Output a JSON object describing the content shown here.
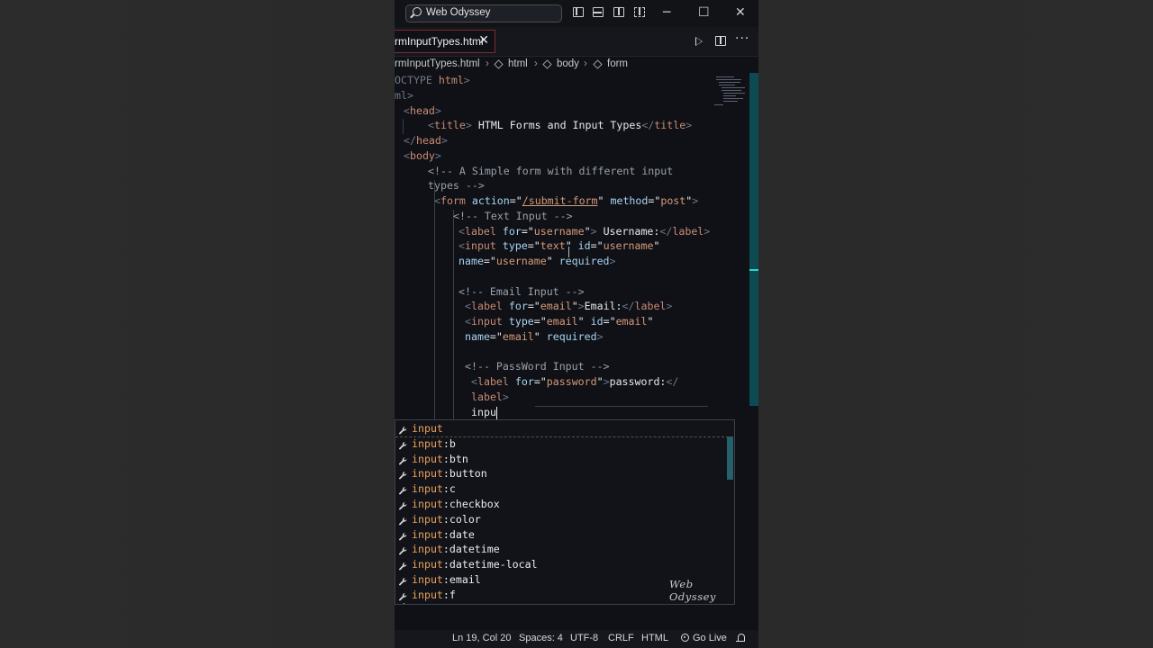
{
  "titlebar": {
    "search_text": "Web Odyssey",
    "icons": [
      "toggle-primary-sidebar-icon",
      "toggle-panel-icon",
      "toggle-secondary-sidebar-icon",
      "customize-layout-icon"
    ],
    "window_controls": {
      "minimize": "─",
      "maximize": "☐",
      "close": "✕"
    }
  },
  "tabs": [
    {
      "label": "rmInputTypes.html",
      "close": "✕",
      "active": true
    }
  ],
  "editor_actions": {
    "run": "run-icon",
    "split": "split-editor-icon",
    "more": "···"
  },
  "breadcrumb": {
    "file": "rmInputTypes.html",
    "items": [
      "html",
      "body",
      "form"
    ],
    "separator": "›"
  },
  "code_lines": [
    [
      {
        "t": "OCTYPE ",
        "c": "tg"
      },
      {
        "t": "html",
        "c": "tn"
      },
      {
        "t": ">",
        "c": "tg"
      }
    ],
    [
      {
        "t": "ml>",
        "c": "tg"
      }
    ],
    [
      {
        "t": "<",
        "c": "tg"
      },
      {
        "t": "head",
        "c": "tn"
      },
      {
        "t": ">",
        "c": "tg"
      }
    ],
    [
      {
        "t": "<",
        "c": "tg"
      },
      {
        "t": "title",
        "c": "tn"
      },
      {
        "t": ">",
        "c": "tg"
      },
      {
        "t": " HTML Forms and Input Types",
        "c": "tx"
      },
      {
        "t": "</",
        "c": "tg"
      },
      {
        "t": "title",
        "c": "tn"
      },
      {
        "t": ">",
        "c": "tg"
      }
    ],
    [
      {
        "t": "</",
        "c": "tg"
      },
      {
        "t": "head",
        "c": "tn"
      },
      {
        "t": ">",
        "c": "tg"
      }
    ],
    [
      {
        "t": "<",
        "c": "tg"
      },
      {
        "t": "body",
        "c": "tn"
      },
      {
        "t": ">",
        "c": "tg"
      }
    ],
    [
      {
        "t": "<!-- A Simple form with different input",
        "c": "cm"
      }
    ],
    [
      {
        "t": "types -->",
        "c": "cm"
      }
    ],
    [
      {
        "t": "<",
        "c": "tg"
      },
      {
        "t": "form",
        "c": "tn"
      },
      {
        "t": " action",
        "c": "at"
      },
      {
        "t": "=\"",
        "c": "tx"
      },
      {
        "t": "/submit-form",
        "c": "vu"
      },
      {
        "t": "\"",
        "c": "tx"
      },
      {
        "t": " method",
        "c": "at"
      },
      {
        "t": "=\"",
        "c": "tx"
      },
      {
        "t": "post",
        "c": "vl"
      },
      {
        "t": "\"",
        "c": "tx"
      },
      {
        "t": ">",
        "c": "tg"
      }
    ],
    [
      {
        "t": "<!-- Text Input -->",
        "c": "cm"
      }
    ],
    [
      {
        "t": "<",
        "c": "tg"
      },
      {
        "t": "label",
        "c": "tn"
      },
      {
        "t": " for",
        "c": "at"
      },
      {
        "t": "=\"",
        "c": "tx"
      },
      {
        "t": "username",
        "c": "vl"
      },
      {
        "t": "\"",
        "c": "tx"
      },
      {
        "t": ">",
        "c": "tg"
      },
      {
        "t": " Username:",
        "c": "tx"
      },
      {
        "t": "</",
        "c": "tg"
      },
      {
        "t": "label",
        "c": "tn"
      },
      {
        "t": ">",
        "c": "tg"
      }
    ],
    [
      {
        "t": "<",
        "c": "tg"
      },
      {
        "t": "input",
        "c": "tn"
      },
      {
        "t": " type",
        "c": "at"
      },
      {
        "t": "=\"",
        "c": "tx"
      },
      {
        "t": "text",
        "c": "vl"
      },
      {
        "t": "\"",
        "c": "tx"
      },
      {
        "t": " id",
        "c": "at"
      },
      {
        "t": "=\"",
        "c": "tx"
      },
      {
        "t": "username",
        "c": "vl"
      },
      {
        "t": "\"",
        "c": "tx"
      }
    ],
    [
      {
        "t": "name",
        "c": "at"
      },
      {
        "t": "=\"",
        "c": "tx"
      },
      {
        "t": "username",
        "c": "vl"
      },
      {
        "t": "\"",
        "c": "tx"
      },
      {
        "t": " required",
        "c": "at"
      },
      {
        "t": ">",
        "c": "tg"
      }
    ],
    [],
    [
      {
        "t": "<!-- Email Input -->",
        "c": "cm"
      }
    ],
    [
      {
        "t": "<",
        "c": "tg"
      },
      {
        "t": "label",
        "c": "tn"
      },
      {
        "t": " for",
        "c": "at"
      },
      {
        "t": "=\"",
        "c": "tx"
      },
      {
        "t": "email",
        "c": "vl"
      },
      {
        "t": "\"",
        "c": "tx"
      },
      {
        "t": ">",
        "c": "tg"
      },
      {
        "t": "Email:",
        "c": "tx"
      },
      {
        "t": "</",
        "c": "tg"
      },
      {
        "t": "label",
        "c": "tn"
      },
      {
        "t": ">",
        "c": "tg"
      }
    ],
    [
      {
        "t": "<",
        "c": "tg"
      },
      {
        "t": "input",
        "c": "tn"
      },
      {
        "t": " type",
        "c": "at"
      },
      {
        "t": "=\"",
        "c": "tx"
      },
      {
        "t": "email",
        "c": "vl"
      },
      {
        "t": "\"",
        "c": "tx"
      },
      {
        "t": " id",
        "c": "at"
      },
      {
        "t": "=\"",
        "c": "tx"
      },
      {
        "t": "email",
        "c": "vl"
      },
      {
        "t": "\"",
        "c": "tx"
      }
    ],
    [
      {
        "t": "name",
        "c": "at"
      },
      {
        "t": "=\"",
        "c": "tx"
      },
      {
        "t": "email",
        "c": "vl"
      },
      {
        "t": "\"",
        "c": "tx"
      },
      {
        "t": " required",
        "c": "at"
      },
      {
        "t": ">",
        "c": "tg"
      }
    ],
    [],
    [
      {
        "t": "<!-- PassWord Input -->",
        "c": "cm"
      }
    ],
    [
      {
        "t": "<",
        "c": "tg"
      },
      {
        "t": "label",
        "c": "tn"
      },
      {
        "t": " for",
        "c": "at"
      },
      {
        "t": "=\"",
        "c": "tx"
      },
      {
        "t": "password",
        "c": "vl"
      },
      {
        "t": "\"",
        "c": "tx"
      },
      {
        "t": ">",
        "c": "tg"
      },
      {
        "t": "password:",
        "c": "tx"
      },
      {
        "t": "</",
        "c": "tg"
      }
    ],
    [
      {
        "t": "label",
        "c": "tn"
      },
      {
        "t": ">",
        "c": "tg"
      }
    ],
    [
      {
        "t": "inpu",
        "c": "tx"
      }
    ]
  ],
  "suggestions": {
    "typed": "input",
    "items": [
      {
        "match": "input",
        "rest": ""
      },
      {
        "match": "input",
        "rest": ":b"
      },
      {
        "match": "input",
        "rest": ":btn"
      },
      {
        "match": "input",
        "rest": ":button"
      },
      {
        "match": "input",
        "rest": ":c"
      },
      {
        "match": "input",
        "rest": ":checkbox"
      },
      {
        "match": "input",
        "rest": ":color"
      },
      {
        "match": "input",
        "rest": ":date"
      },
      {
        "match": "input",
        "rest": ":datetime"
      },
      {
        "match": "input",
        "rest": ":datetime-local"
      },
      {
        "match": "input",
        "rest": ":email"
      },
      {
        "match": "input",
        "rest": ":f"
      }
    ],
    "watermark": "Web Odyssey"
  },
  "statusbar": {
    "position": "Ln 19, Col 20",
    "spaces": "Spaces: 4",
    "encoding": "UTF-8",
    "eol": "CRLF",
    "language": "HTML",
    "golive": "Go Live"
  },
  "colors": {
    "background": "#0f1117",
    "tag": "#ca8b73",
    "attribute": "#a8d4f0",
    "string": "#d69a78",
    "match_highlight": "#e9a15c",
    "scrollbar": "#2dd4d0"
  }
}
